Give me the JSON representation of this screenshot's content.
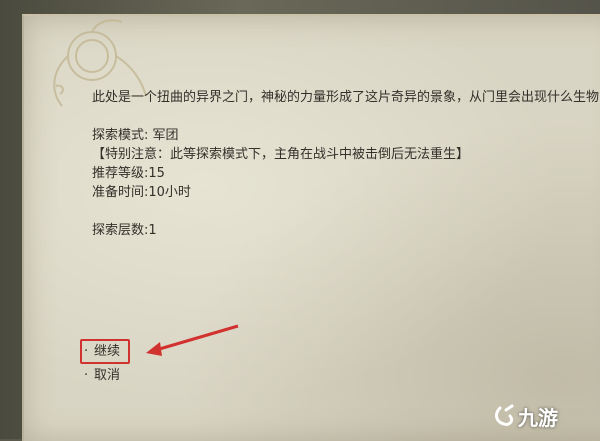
{
  "dialog": {
    "description": "此处是一个扭曲的异界之门，神秘的力量形成了这片奇异的景象，从门里会出现什么生物",
    "mode_line": "探索模式: 军团",
    "warning_line": "【特别注意：此等探索模式下，主角在战斗中被击倒后无法重生】",
    "level_line": "推荐等级:15",
    "prep_time_line": "准备时间:10小时",
    "floors_line": "探索层数:1"
  },
  "options": [
    {
      "bullet": "·",
      "label": "继续"
    },
    {
      "bullet": "·",
      "label": "取消"
    }
  ],
  "annotation": {
    "highlight_color": "#d2322f"
  },
  "watermark": {
    "text": "九游",
    "icon": "jiuyou-logo-icon"
  }
}
